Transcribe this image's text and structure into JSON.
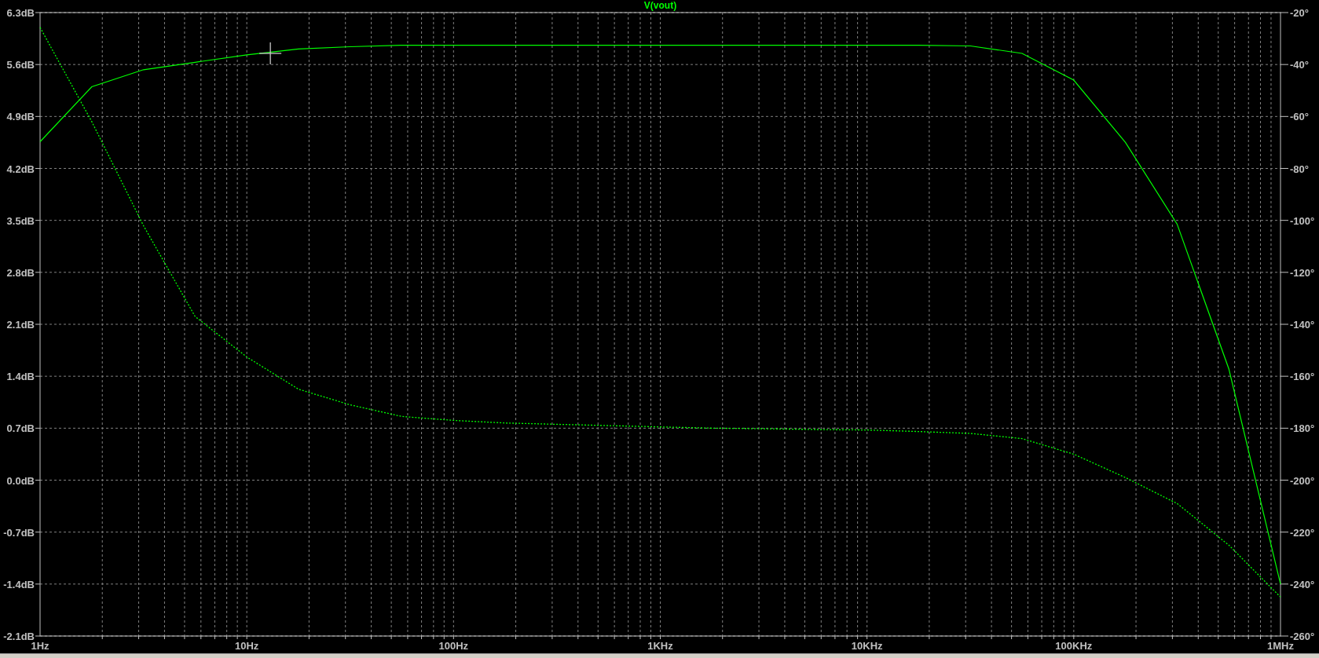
{
  "plot": {
    "chart_data": {
      "type": "line",
      "title": "V(vout)",
      "grid": true,
      "categories": [
        "1Hz",
        null,
        null,
        null,
        "10Hz",
        null,
        null,
        null,
        "100Hz",
        null,
        null,
        null,
        "1KHz",
        null,
        null,
        null,
        "10KHz",
        null,
        null,
        null,
        "100KHz",
        null,
        null,
        null,
        "1MHz"
      ],
      "ylim": [
        -2.1,
        6.3
      ],
      "yticks": [
        {
          "value": 6.3,
          "label": "6.3dB"
        },
        {
          "value": 5.6,
          "label": "5.6dB"
        },
        {
          "value": 4.9,
          "label": "4.9dB"
        },
        {
          "value": 4.2,
          "label": "4.2dB"
        },
        {
          "value": 3.5,
          "label": "3.5dB"
        },
        {
          "value": 2.8,
          "label": "2.8dB"
        },
        {
          "value": 2.1,
          "label": "2.1dB"
        },
        {
          "value": 1.4,
          "label": "1.4dB"
        },
        {
          "value": 0.7,
          "label": "0.7dB"
        },
        {
          "value": 0,
          "label": "0.0dB"
        },
        {
          "value": -0.7,
          "label": "-0.7dB"
        },
        {
          "value": -1.4,
          "label": "-1.4dB"
        },
        {
          "value": -2.1,
          "label": "-2.1dB"
        }
      ],
      "y2lim": [
        -260,
        -20
      ],
      "y2ticks": [
        {
          "value": -20,
          "label": "-20°"
        },
        {
          "value": -40,
          "label": "-40°"
        },
        {
          "value": -60,
          "label": "-60°"
        },
        {
          "value": -80,
          "label": "-80°"
        },
        {
          "value": -100,
          "label": "-100°"
        },
        {
          "value": -120,
          "label": "-120°"
        },
        {
          "value": -140,
          "label": "-140°"
        },
        {
          "value": -160,
          "label": "-160°"
        },
        {
          "value": -180,
          "label": "-180°"
        },
        {
          "value": -200,
          "label": "-200°"
        },
        {
          "value": -220,
          "label": "-220°"
        },
        {
          "value": -240,
          "label": "-240°"
        },
        {
          "value": -260,
          "label": "-260°"
        }
      ],
      "series": [
        {
          "color": "#00ff00",
          "values": [
            4.56,
            5.3,
            5.53,
            5.63,
            5.73,
            5.81,
            5.84,
            5.86,
            5.86,
            5.86,
            5.86,
            5.86,
            5.86,
            5.86,
            5.86,
            5.86,
            5.86,
            5.86,
            5.85,
            5.75,
            5.39,
            4.55,
            3.45,
            1.5,
            -1.4
          ]
        },
        {
          "color": "#00ff00",
          "axis": "y2",
          "line_style": "dotted",
          "values": [
            -25.7,
            -62,
            -102,
            -137,
            -152.6,
            -165,
            -171,
            -175.5,
            -177,
            -178,
            -178.5,
            -179,
            -179.5,
            -180,
            -180.2,
            -180.5,
            -180.7,
            -181.3,
            -182,
            -184,
            -190,
            -199,
            -209,
            -225,
            -245
          ]
        }
      ]
    }
  }
}
